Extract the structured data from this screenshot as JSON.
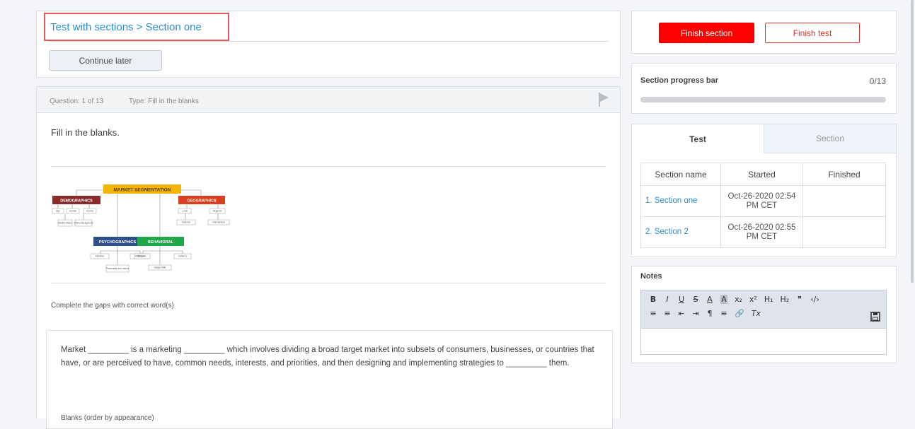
{
  "header": {
    "breadcrumb": "Test with sections > Section one",
    "continue_later_label": "Continue later"
  },
  "question": {
    "number_label": "Question: 1 of 13",
    "type_label": "Type: Fill in the blanks",
    "instruction": "Fill in the blanks.",
    "gap_instruction": "Complete the gaps with correct word(s)",
    "answer_text": "Market _________ is a marketing _________ which involves dividing a broad target market into subsets of consumers, businesses, or countries that have, or are perceived to have, common needs, interests, and priorities, and then designing and implementing strategies to _________ them.",
    "blanks_label": "Blanks (order by appearance)"
  },
  "diagram": {
    "root": "MARKET SEGMENTATION",
    "demographics": "DEMOGRAPHICS",
    "geographics": "GEOGRAPHICS",
    "psychographics": "PSYCHOGRAPHICS",
    "behavioral": "BEHAVIORAL",
    "demo_leaves": [
      "Age",
      "Gender",
      "Income",
      "Marital Status",
      "Ethnic Background"
    ],
    "geo_leaves": [
      "Local",
      "Regional",
      "National",
      "International"
    ],
    "psycho_leaves": [
      "Activities",
      "Attitudes",
      "Personality and Values"
    ],
    "behav_leaves": [
      "Benefits",
      "Patterns",
      "Usage Rate"
    ],
    "colors": {
      "root": "#f5b400",
      "demographics": "#8b2a2a",
      "geographics": "#d9401f",
      "psychographics": "#2e4f8a",
      "behavioral": "#1fa84a"
    }
  },
  "actions": {
    "finish_section_label": "Finish section",
    "finish_test_label": "Finish test"
  },
  "progress": {
    "label": "Section progress bar",
    "count": "0/13",
    "fraction": 0
  },
  "tabs": {
    "test_label": "Test",
    "section_label": "Section"
  },
  "sections_table": {
    "headers": [
      "Section name",
      "Started",
      "Finished"
    ],
    "rows": [
      {
        "name": "1. Section one",
        "started": "Oct-26-2020 02:54 PM CET",
        "finished": ""
      },
      {
        "name": "2. Section 2",
        "started": "Oct-26-2020 02:55 PM CET",
        "finished": ""
      }
    ]
  },
  "notes": {
    "label": "Notes",
    "toolbar_row1": [
      "B",
      "I",
      "U",
      "S",
      "A",
      "A",
      "x₂",
      "x²",
      "H₁",
      "H₂",
      "❞",
      "‹/›"
    ],
    "toolbar_row2": [
      "≡",
      "≡",
      "⇤",
      "⇥",
      "¶",
      "≡",
      "🔗",
      "Tx"
    ]
  },
  "colors": {
    "accent": "#2a8fd0",
    "danger": "#ff0000"
  }
}
